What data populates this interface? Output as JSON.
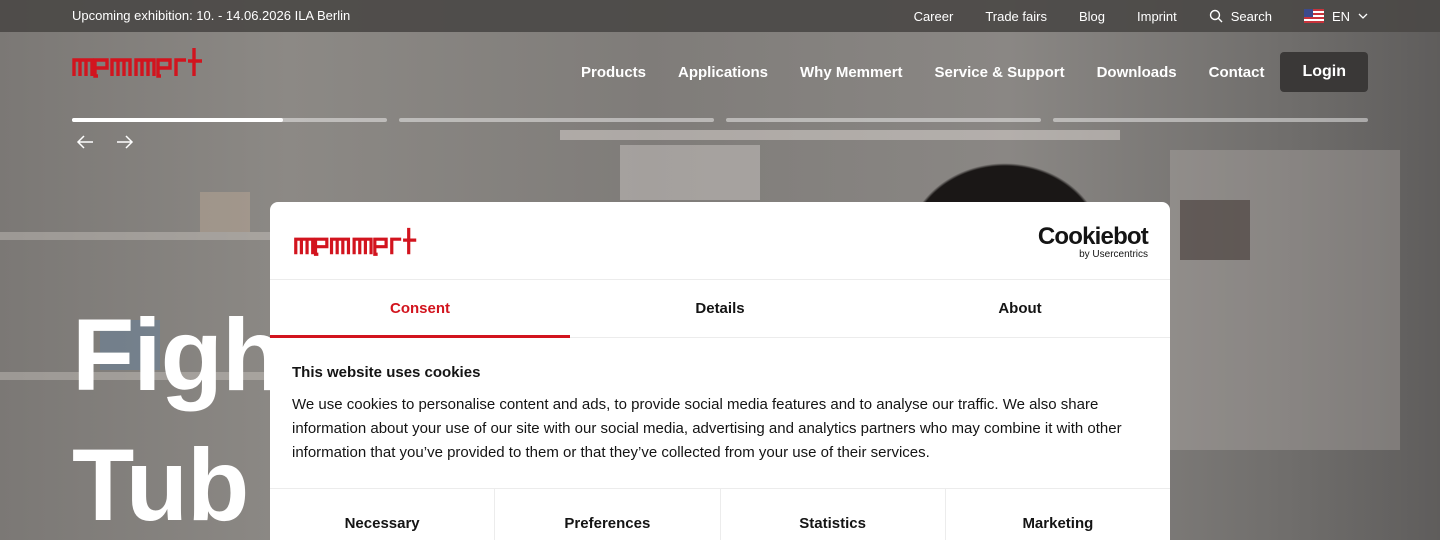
{
  "colors": {
    "brand_red": "#d2141e",
    "topbar_bg": "#4b4947",
    "dialog_bg": "#ffffff"
  },
  "topbar": {
    "exhibition": "Upcoming exhibition: 10. - 14.06.2026 ILA Berlin",
    "links": [
      "Career",
      "Trade fairs",
      "Blog",
      "Imprint"
    ],
    "search_label": "Search",
    "language": "EN",
    "icons": {
      "search": "search-icon",
      "flag": "us-flag-icon",
      "chevron": "chevron-down-icon"
    }
  },
  "header": {
    "logo_text": "memmert",
    "nav": [
      "Products",
      "Applications",
      "Why Memmert",
      "Service & Support",
      "Downloads",
      "Contact"
    ],
    "login": "Login"
  },
  "slider": {
    "slides": 4,
    "active_index": 0,
    "active_progress": 0.67,
    "prev_icon": "arrow-left-icon",
    "next_icon": "arrow-right-icon"
  },
  "hero": {
    "line1": "Figh",
    "line2": "Tub"
  },
  "cookie_dialog": {
    "logo_text": "memmert",
    "provider": "Cookiebot",
    "provider_by": "by Usercentrics",
    "tabs": [
      {
        "label": "Consent",
        "active": true
      },
      {
        "label": "Details",
        "active": false
      },
      {
        "label": "About",
        "active": false
      }
    ],
    "heading": "This website uses cookies",
    "text": "We use cookies to personalise content and ads, to provide social media features and to analyse our traffic. We also share information about your use of our site with our social media, advertising and analytics partners who may combine it with other information that you’ve provided to them or that they’ve collected from your use of their services.",
    "categories": [
      "Necessary",
      "Preferences",
      "Statistics",
      "Marketing"
    ]
  }
}
